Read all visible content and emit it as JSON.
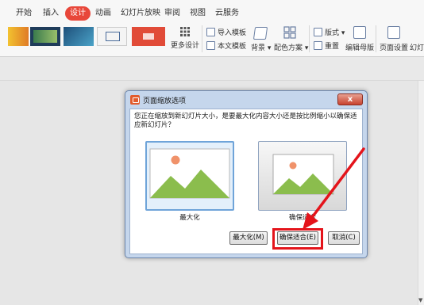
{
  "ribbon": {
    "tabs": [
      {
        "label": "开始",
        "active": false
      },
      {
        "label": "插入",
        "active": false
      },
      {
        "label": "设计",
        "active": true
      },
      {
        "label": "动画",
        "active": false
      },
      {
        "label": "幻灯片放映",
        "active": false
      },
      {
        "label": "审阅",
        "active": false
      },
      {
        "label": "视图",
        "active": false
      },
      {
        "label": "云服务",
        "active": false
      }
    ],
    "more_designs": "更多设计",
    "import_template": "导入模板",
    "body_template": "本文模板",
    "background": "背景",
    "color_scheme": "配色方案",
    "layout": "版式",
    "reset": "重置",
    "edit_master": "编辑母版",
    "page_setup": "页面设置",
    "slide_size_partial": "幻灯"
  },
  "dialog": {
    "title": "页面缩放选项",
    "close_glyph": "x",
    "message": "您正在缩放到新幻灯片大小，是要最大化内容大小还是按比例缩小以确保适应新幻灯片？",
    "option_maximize": "最大化",
    "option_ensure_fit": "确保适合",
    "selected_option": "maximize",
    "buttons": {
      "maximize": "最大化(M)",
      "ensure_fit": "确保适合(E)",
      "cancel": "取消(C)"
    }
  },
  "colors": {
    "active_tab": "#e8473a",
    "highlight": "#e4141b",
    "dialog_frame": "#c5d6ec",
    "mountain": "#8bbd4d",
    "sun": "#f0926a"
  }
}
